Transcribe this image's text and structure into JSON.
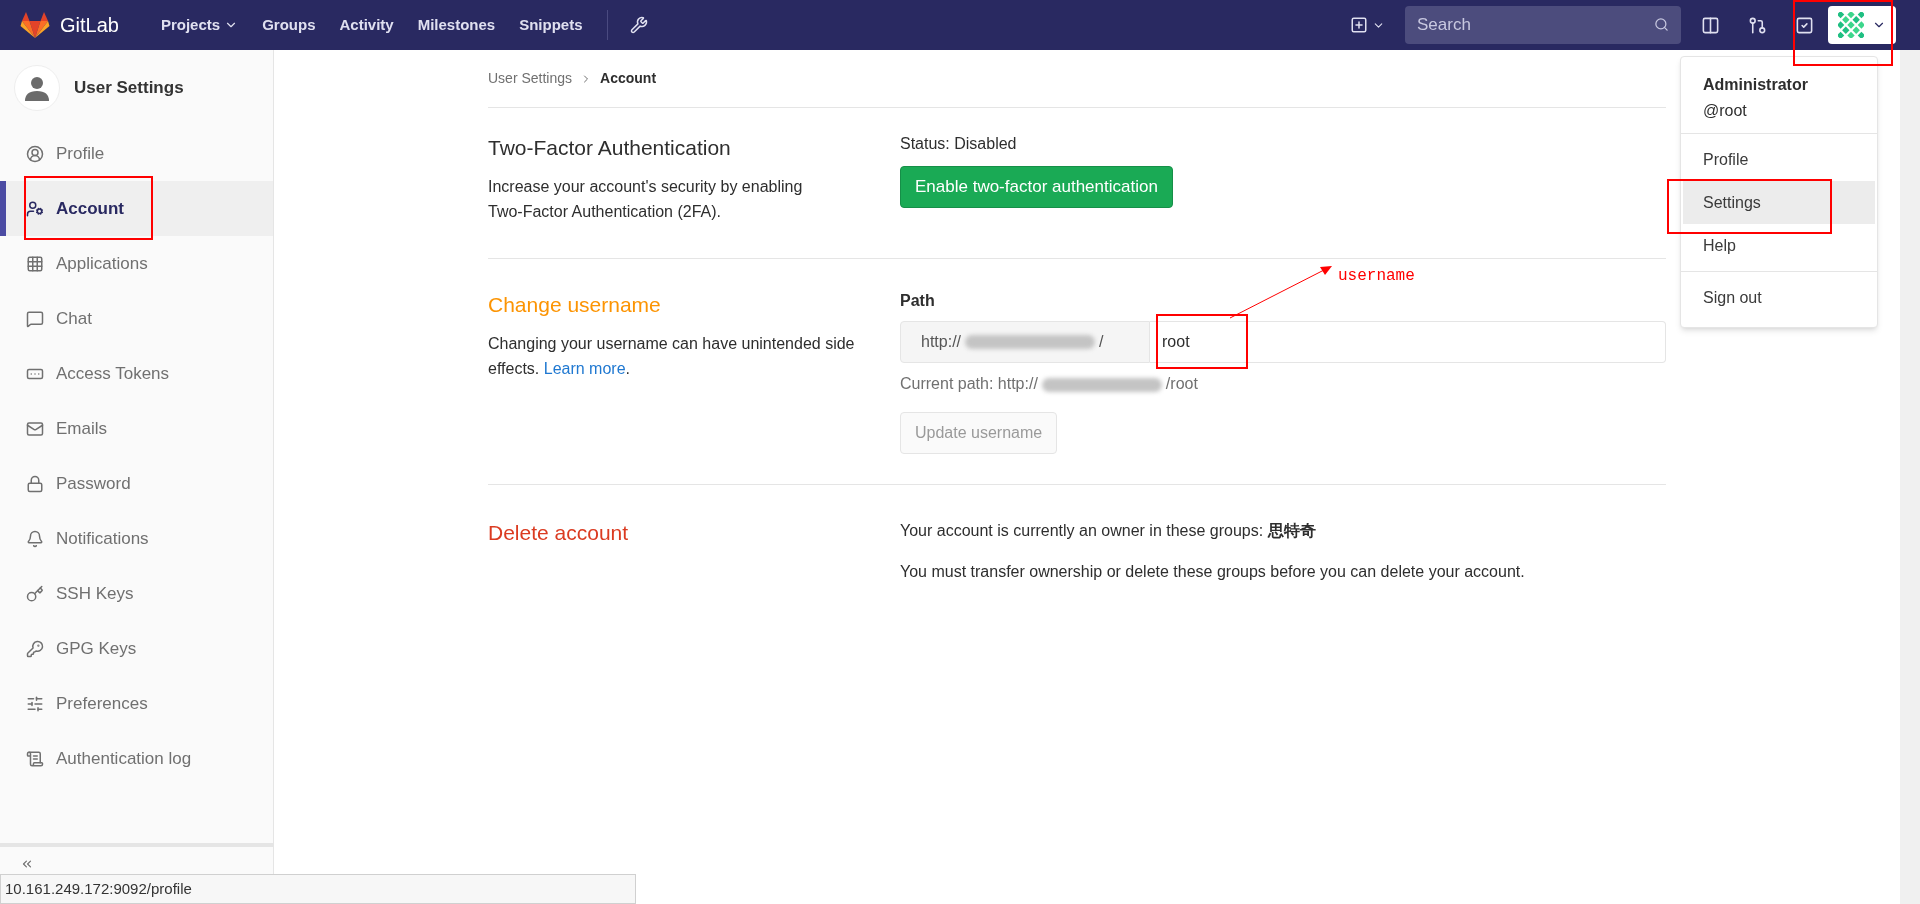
{
  "navbar": {
    "brand": "GitLab",
    "links": [
      {
        "label": "Projects",
        "has_menu": true
      },
      {
        "label": "Groups",
        "has_menu": false
      },
      {
        "label": "Activity",
        "has_menu": false
      },
      {
        "label": "Milestones",
        "has_menu": false
      },
      {
        "label": "Snippets",
        "has_menu": false
      }
    ],
    "search": {
      "placeholder": "Search"
    }
  },
  "sidebar": {
    "title": "User Settings",
    "items": [
      {
        "label": "Profile",
        "selected": false
      },
      {
        "label": "Account",
        "selected": true
      },
      {
        "label": "Applications",
        "selected": false
      },
      {
        "label": "Chat",
        "selected": false
      },
      {
        "label": "Access Tokens",
        "selected": false
      },
      {
        "label": "Emails",
        "selected": false
      },
      {
        "label": "Password",
        "selected": false
      },
      {
        "label": "Notifications",
        "selected": false
      },
      {
        "label": "SSH Keys",
        "selected": false
      },
      {
        "label": "GPG Keys",
        "selected": false
      },
      {
        "label": "Preferences",
        "selected": false
      },
      {
        "label": "Authentication log",
        "selected": false
      }
    ]
  },
  "breadcrumb": [
    "User Settings",
    "Account"
  ],
  "two_factor": {
    "title": "Two-Factor Authentication",
    "description": "Increase your account's security by enabling Two-Factor Authentication (2FA).",
    "status": "Status: Disabled",
    "button": "Enable two-factor authentication"
  },
  "change_username": {
    "title": "Change username",
    "description": "Changing your username can have unintended side effects.",
    "link": "Learn more",
    "link_after": ".",
    "path_label": "Path",
    "prefix_start": "http://",
    "prefix_end": "/",
    "value": "root",
    "current_start": "Current path: http://",
    "current_end": "/root",
    "button": "Update username",
    "button_disabled": true
  },
  "delete_account": {
    "title": "Delete account",
    "text": "Your account is currently an owner in these groups: **思特奇**",
    "note": "You must transfer ownership or delete these groups before you can delete your account."
  },
  "user_menu": {
    "name": "Administrator",
    "handle": "@root",
    "groups": [
      {
        "items": [
          {
            "label": "Profile",
            "selected": false
          },
          {
            "label": "Settings",
            "selected": true
          },
          {
            "label": "Help",
            "selected": false
          }
        ]
      },
      {
        "items": [
          {
            "label": "Sign out",
            "selected": false
          }
        ]
      }
    ]
  },
  "annotation": {
    "label": "username"
  },
  "status_bar": {
    "url": "10.161.249.172:9092/profile"
  }
}
